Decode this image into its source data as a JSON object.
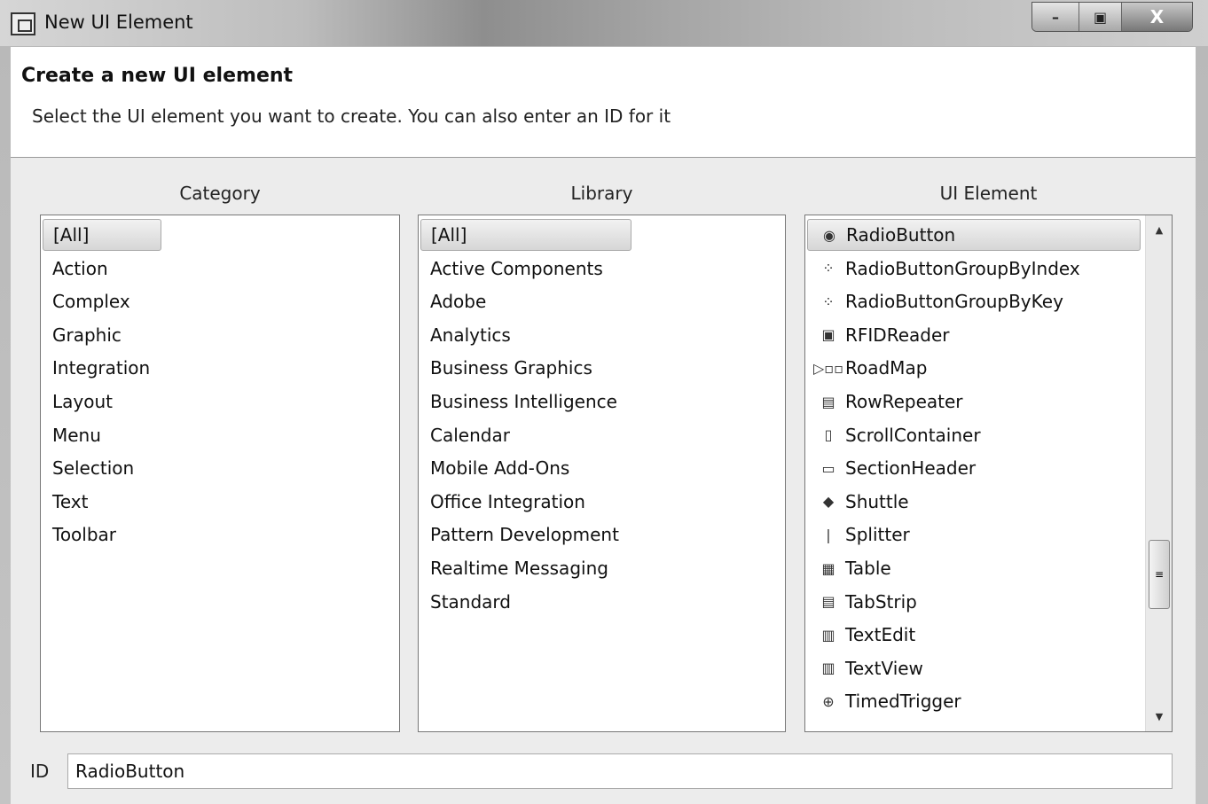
{
  "window": {
    "title": "New UI Element",
    "minimize": "–",
    "maximize": "▣",
    "close": "X"
  },
  "header": {
    "title": "Create a new UI element",
    "description": "Select the UI element you want to create. You can also enter an ID for it"
  },
  "category": {
    "heading": "Category",
    "items": [
      "[All]",
      "Action",
      "Complex",
      "Graphic",
      "Integration",
      "Layout",
      "Menu",
      "Selection",
      "Text",
      "Toolbar"
    ],
    "selected": "[All]"
  },
  "library": {
    "heading": "Library",
    "items": [
      "[All]",
      "Active Components",
      "Adobe",
      "Analytics",
      "Business Graphics",
      "Business Intelligence",
      "Calendar",
      "Mobile Add-Ons",
      "Office Integration",
      "Pattern Development",
      "Realtime Messaging",
      "Standard"
    ],
    "selected": "[All]"
  },
  "ui_element": {
    "heading": "UI Element",
    "selected": "RadioButton",
    "items": [
      {
        "label": "RadioButton",
        "icon": "radio-button-icon",
        "glyph": "◉"
      },
      {
        "label": "RadioButtonGroupByIndex",
        "icon": "radio-group-index-icon",
        "glyph": "⁘"
      },
      {
        "label": "RadioButtonGroupByKey",
        "icon": "radio-group-key-icon",
        "glyph": "⁘"
      },
      {
        "label": "RFIDReader",
        "icon": "rfid-reader-icon",
        "glyph": "▣"
      },
      {
        "label": "RoadMap",
        "icon": "roadmap-icon",
        "glyph": "▷▫▫"
      },
      {
        "label": "RowRepeater",
        "icon": "row-repeater-icon",
        "glyph": "▤"
      },
      {
        "label": "ScrollContainer",
        "icon": "scroll-container-icon",
        "glyph": "▯"
      },
      {
        "label": "SectionHeader",
        "icon": "section-header-icon",
        "glyph": "▭"
      },
      {
        "label": "Shuttle",
        "icon": "shuttle-icon",
        "glyph": "◆"
      },
      {
        "label": "Splitter",
        "icon": "splitter-icon",
        "glyph": "|"
      },
      {
        "label": "Table",
        "icon": "table-icon",
        "glyph": "▦"
      },
      {
        "label": "TabStrip",
        "icon": "tabstrip-icon",
        "glyph": "▤"
      },
      {
        "label": "TextEdit",
        "icon": "text-edit-icon",
        "glyph": "▥"
      },
      {
        "label": "TextView",
        "icon": "text-view-icon",
        "glyph": "▥"
      },
      {
        "label": "TimedTrigger",
        "icon": "timed-trigger-icon",
        "glyph": "⊕"
      }
    ],
    "scroll": {
      "up": "▲",
      "down": "▼",
      "grip": "≡"
    }
  },
  "id_field": {
    "label": "ID",
    "value": "RadioButton"
  }
}
